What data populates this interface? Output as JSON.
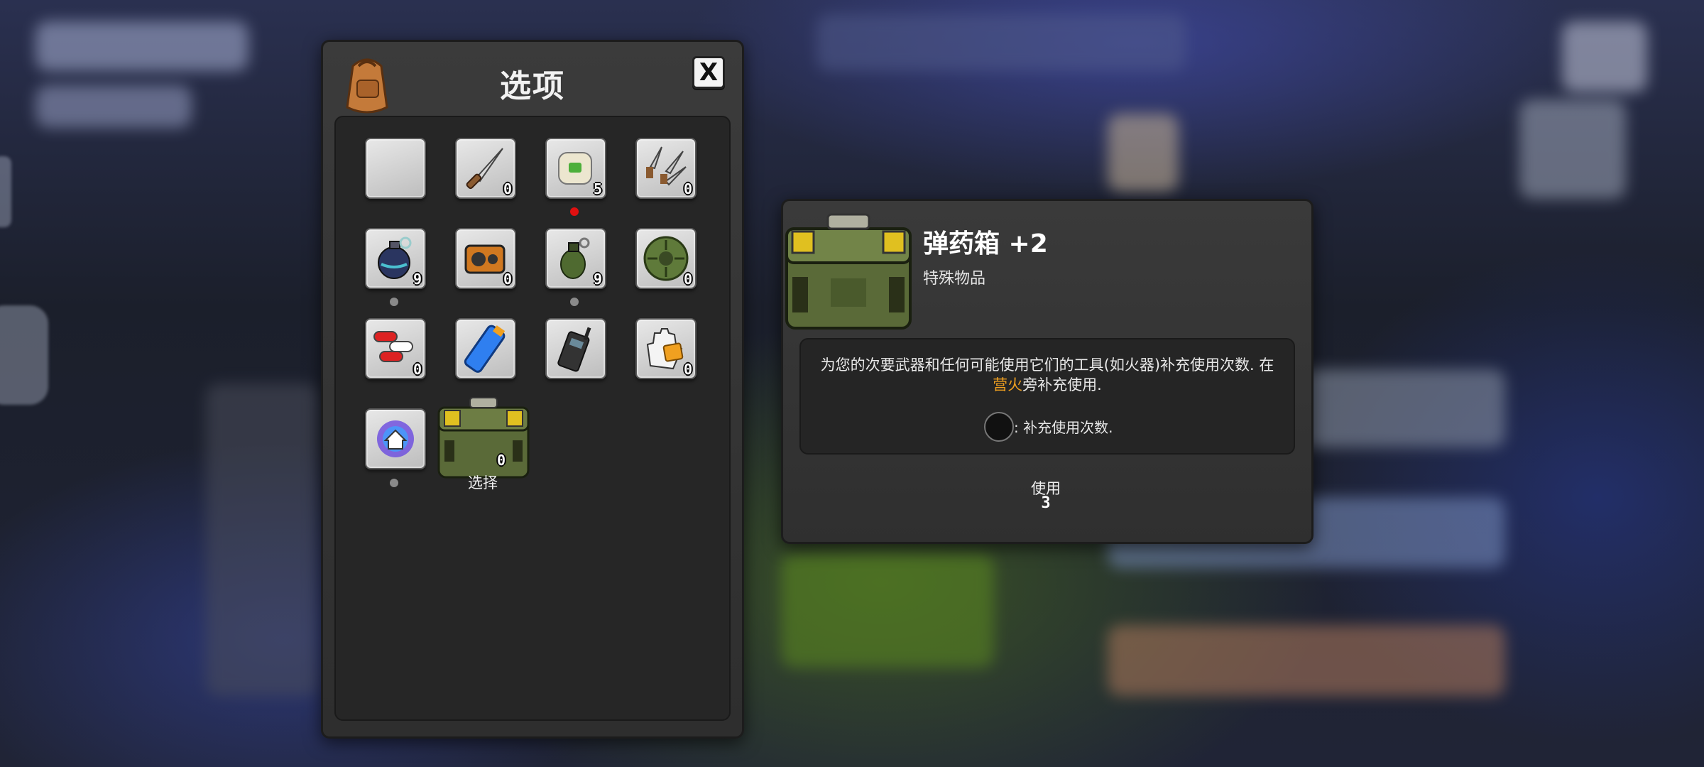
{
  "inventory": {
    "title": "选项",
    "close_label": "X",
    "selected_label": "选择",
    "selected_count": "0",
    "slots": [
      {
        "icon": "empty-slot",
        "count": ""
      },
      {
        "icon": "knife-icon",
        "count": "0"
      },
      {
        "icon": "bandage-roll-icon",
        "count": "5"
      },
      {
        "icon": "throwing-knives-icon",
        "count": "0"
      },
      {
        "icon": "frag-grenade-icon",
        "count": "9"
      },
      {
        "icon": "radio-device-icon",
        "count": "0"
      },
      {
        "icon": "green-grenade-icon",
        "count": "9"
      },
      {
        "icon": "landmine-icon",
        "count": "0"
      },
      {
        "icon": "pills-icon",
        "count": "0"
      },
      {
        "icon": "blue-canister-icon",
        "count": ""
      },
      {
        "icon": "walkie-talkie-icon",
        "count": ""
      },
      {
        "icon": "glove-icon",
        "count": "0"
      },
      {
        "icon": "home-teleport-icon",
        "count": ""
      }
    ]
  },
  "detail": {
    "name": "弹药箱 +2",
    "type": "特殊物品",
    "description_part1": "为您的次要武器和任何可能使用它们的工具(如火器)补充使用次数. 在 ",
    "description_highlight": "营火",
    "description_part2": "旁补充使用.",
    "refill_text": ": 补充使用次数.",
    "use_label": "使用",
    "use_count": "3"
  },
  "colors": {
    "highlight": "#f0a020",
    "notify_red": "#e01010",
    "panel": "#333333"
  }
}
